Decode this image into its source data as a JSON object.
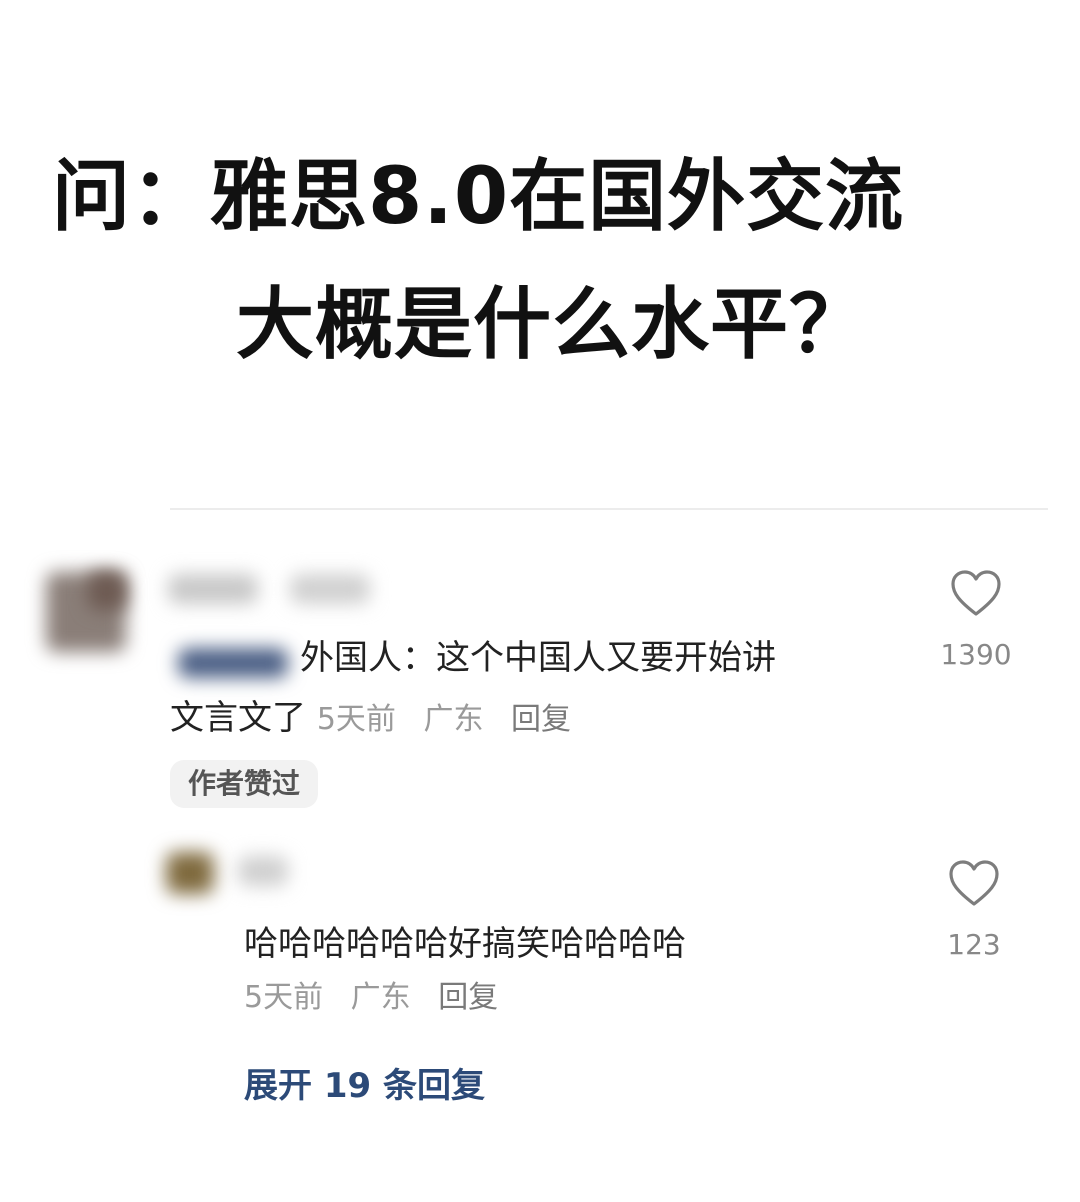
{
  "question": {
    "line1": "问：雅思8.0在国外交流",
    "line2": "大概是什么水平？"
  },
  "comments": [
    {
      "text_line1": "外国人：这个中国人又要开始讲",
      "text_line2": "文言文了",
      "time": "5天前",
      "location": "广东",
      "reply_label": "回复",
      "badge": "作者赞过",
      "like_count": "1390"
    },
    {
      "text_line1": "哈哈哈哈哈哈好搞笑哈哈哈哈",
      "time": "5天前",
      "location": "广东",
      "reply_label": "回复",
      "like_count": "123"
    }
  ],
  "expand_replies": "展开 19 条回复",
  "colors": {
    "link": "#2c4a78",
    "meta": "#9a9a9a",
    "text": "#222222"
  },
  "icons": {
    "like": "heart-outline-icon"
  }
}
